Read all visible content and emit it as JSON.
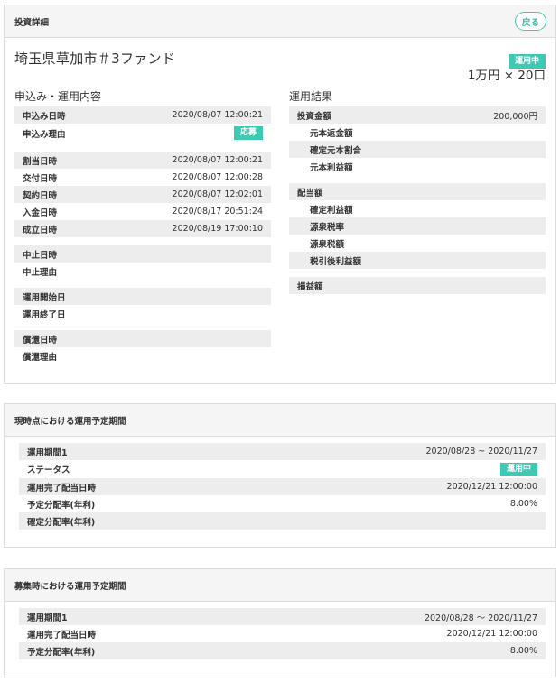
{
  "detail": {
    "header_title": "投資詳細",
    "back_label": "戻る",
    "fund_name": "埼玉県草加市＃3ファンド",
    "status": "運用中",
    "units": "1万円 × 20口",
    "application_title": "申込み・運用内容",
    "application_rows": [
      {
        "label": "申込み日時",
        "value": "2020/08/07 12:00:21"
      },
      {
        "label": "申込み理由",
        "value": "応募"
      },
      {
        "label": "割当日時",
        "value": "2020/08/07 12:00:21"
      },
      {
        "label": "交付日時",
        "value": "2020/08/07 12:00:28"
      },
      {
        "label": "契約日時",
        "value": "2020/08/07 12:02:01"
      },
      {
        "label": "入金日時",
        "value": "2020/08/17 20:51:24"
      },
      {
        "label": "成立日時",
        "value": "2020/08/19 17:00:10"
      },
      {
        "label": "中止日時",
        "value": ""
      },
      {
        "label": "中止理由",
        "value": ""
      },
      {
        "label": "運用開始日",
        "value": ""
      },
      {
        "label": "運用終了日",
        "value": ""
      },
      {
        "label": "償還日時",
        "value": ""
      },
      {
        "label": "償還理由",
        "value": ""
      }
    ],
    "result_title": "運用結果",
    "result_rows": [
      {
        "label": "投資金額",
        "value": "200,000円"
      },
      {
        "label": "元本返金額",
        "value": ""
      },
      {
        "label": "確定元本割合",
        "value": ""
      },
      {
        "label": "元本利益額",
        "value": ""
      },
      {
        "label": "配当額",
        "value": ""
      },
      {
        "label": "確定利益額",
        "value": ""
      },
      {
        "label": "源泉税率",
        "value": ""
      },
      {
        "label": "源泉税額",
        "value": ""
      },
      {
        "label": "税引後利益額",
        "value": ""
      },
      {
        "label": "損益額",
        "value": ""
      }
    ]
  },
  "current_plan": {
    "header_title": "現時点における運用予定期間",
    "rows": [
      {
        "label": "運用期間1",
        "value": "2020/08/28 ~ 2020/11/27"
      },
      {
        "label": "ステータス",
        "value": "運用中"
      },
      {
        "label": "運用完了配当日時",
        "value": "2020/12/21 12:00:00"
      },
      {
        "label": "予定分配率(年利)",
        "value": "8.00%"
      },
      {
        "label": "確定分配率(年利)",
        "value": ""
      }
    ]
  },
  "recruit_plan": {
    "header_title": "募集時における運用予定期間",
    "rows": [
      {
        "label": "運用期間1",
        "value": "2020/08/28 〜 2020/11/27"
      },
      {
        "label": "運用完了配当日時",
        "value": "2020/12/21 12:00:00"
      },
      {
        "label": "予定分配率(年利)",
        "value": "8.00%"
      }
    ]
  },
  "colors": {
    "accent": "#3ec9b3",
    "row_shade": "#ededed",
    "header_bg": "#f5f5f5",
    "border": "#dcdcdc"
  }
}
